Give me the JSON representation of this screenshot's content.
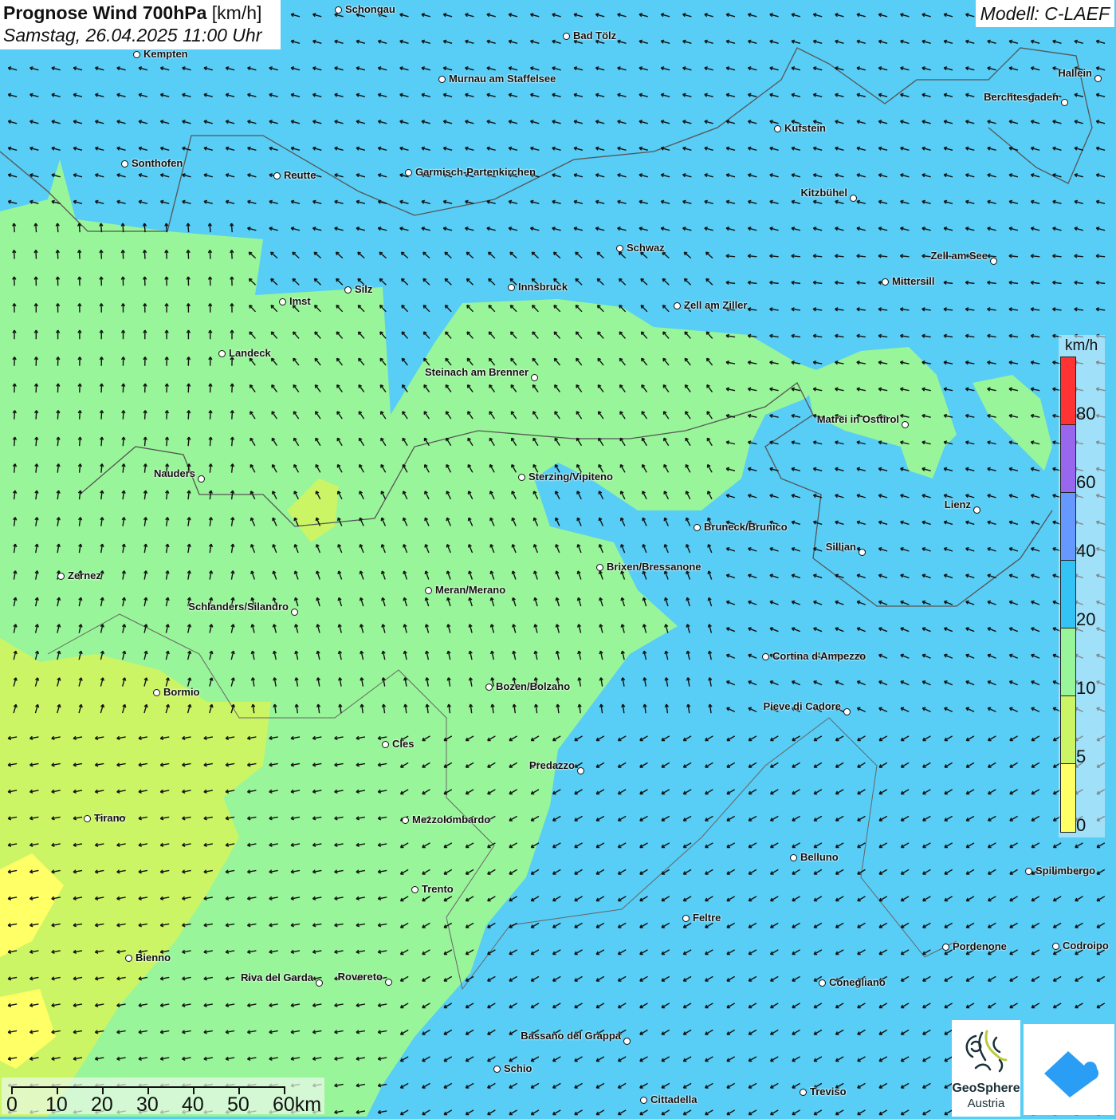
{
  "title": {
    "main_bold": "Prognose Wind 700hPa",
    "unit": "[km/h]",
    "datetime": "Samstag, 26.04.2025 11:00 Uhr"
  },
  "model": "Modell: C-LAEF",
  "legend": {
    "unit": "km/h",
    "ticks": [
      "80",
      "60",
      "40",
      "20",
      "10",
      "5",
      "0"
    ],
    "colors": [
      "#ff3333",
      "#9966ee",
      "#6699ff",
      "#33c4f5",
      "#99f599",
      "#ccf566",
      "#ffff66"
    ]
  },
  "scale_bar": {
    "labels": [
      "0",
      "10",
      "20",
      "30",
      "40",
      "50",
      "60km"
    ]
  },
  "map_colors": {
    "wind_10_20": "#99f599",
    "wind_20_40": "#58cdf5",
    "wind_5_10": "#ccf566",
    "wind_0_5": "#ffff66",
    "borders": "#555555"
  },
  "cities": [
    "Schongau",
    "Bad Tölz",
    "Kempten",
    "Murnau am Staffelsee",
    "Hallein",
    "Berchtesgaden",
    "Kufstein",
    "Sonthofen",
    "Reutte",
    "Garmisch-Partenkirchen",
    "Kitzbühel",
    "Schwaz",
    "Zell am See",
    "Mittersill",
    "Silz",
    "Innsbruck",
    "Imst",
    "Zell am Ziller",
    "Landeck",
    "Steinach am Brenner",
    "Matrei in Osttirol",
    "Nauders",
    "Sterzing/Vipiteno",
    "Lienz",
    "Bruneck/Brunico",
    "Sillian",
    "Brixen/Bressanone",
    "Zernez",
    "Meran/Merano",
    "Schlanders/Silandro",
    "Cortina d'Ampezzo",
    "Bozen/Bolzano",
    "Bormio",
    "Pieve di Cadore",
    "Cles",
    "Predazzo",
    "Tirano",
    "Mezzolombardo",
    "Belluno",
    "Spilimbergo",
    "Feltre",
    "Trento",
    "Pordenone",
    "Codroipo",
    "Bienno",
    "Riva del Garda",
    "Rovereto",
    "Conegliano",
    "Bassano del Grappa",
    "Schio",
    "Treviso",
    "Cittadella"
  ],
  "logos": {
    "geosphere_line1": "GeoSphere",
    "geosphere_line2": "Austria"
  }
}
